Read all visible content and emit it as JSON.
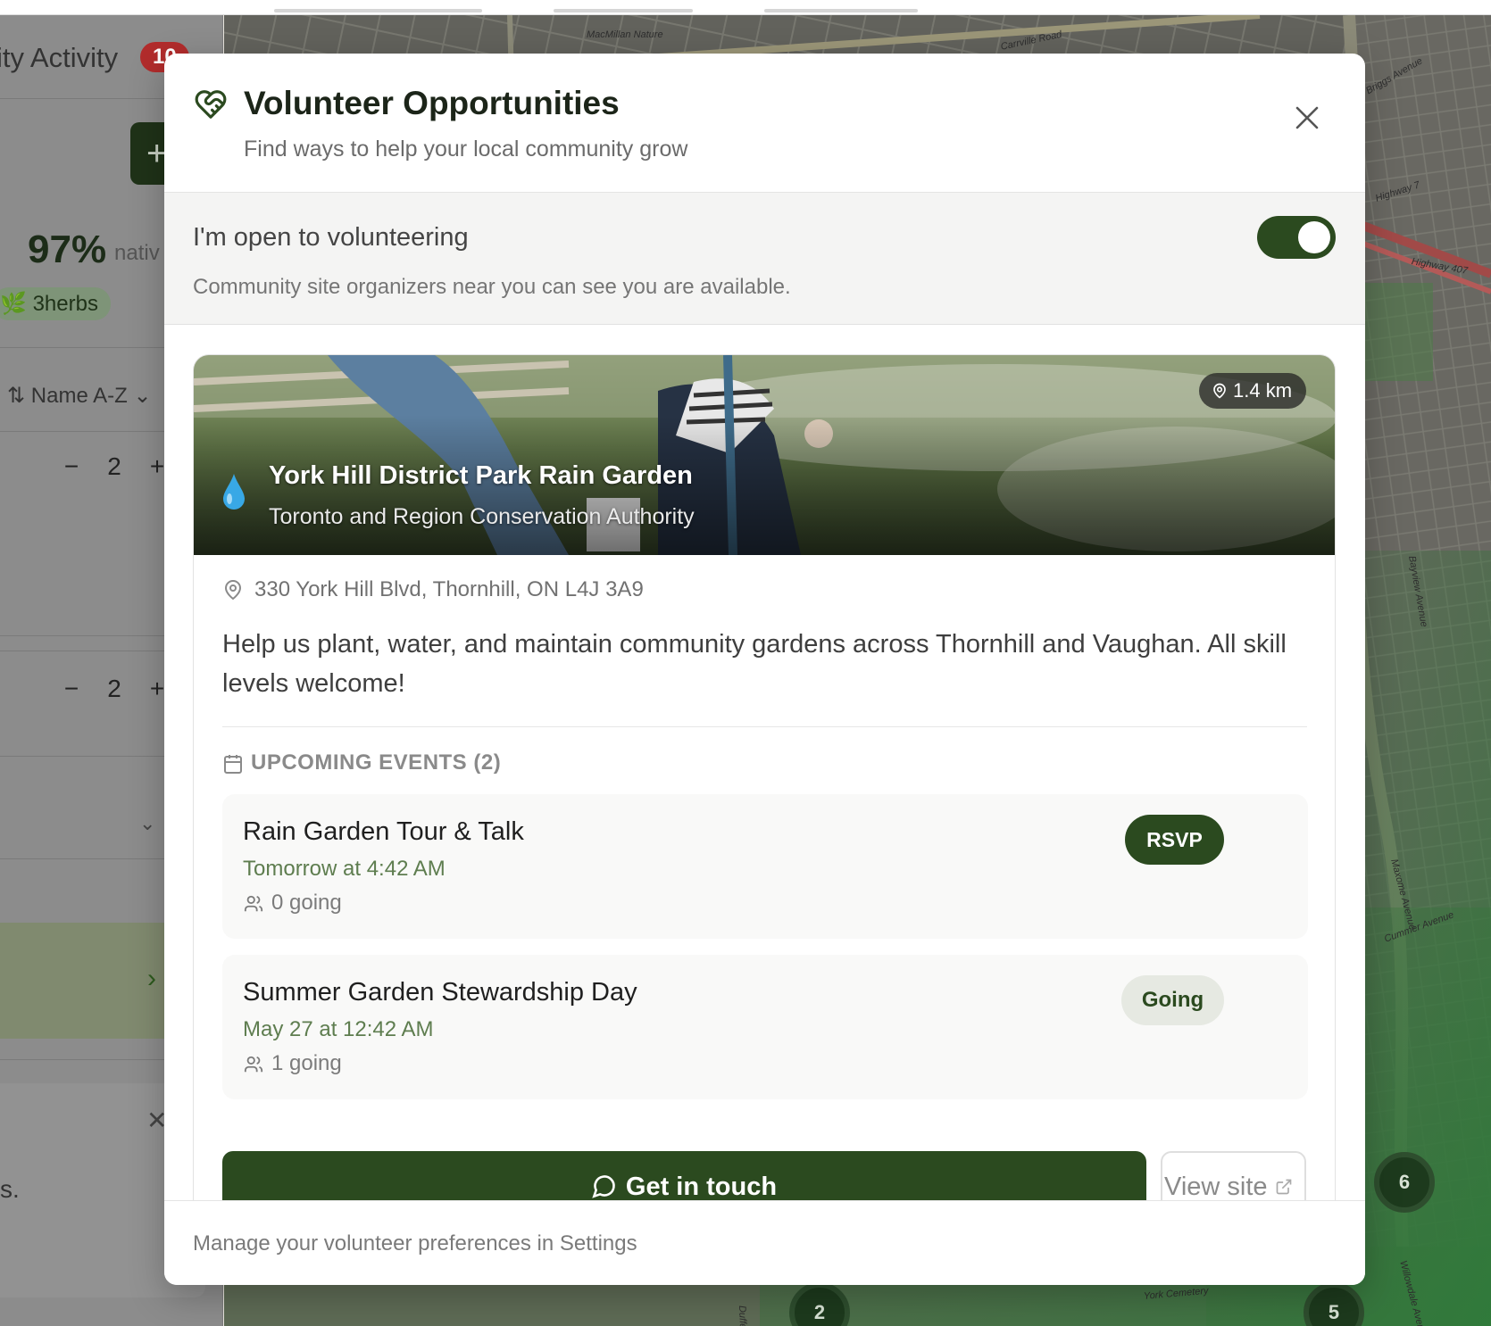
{
  "background": {
    "left_panel": {
      "title": "ity Activity",
      "badge": "10",
      "add_glyph": "+",
      "native_pct": "97%",
      "native_label": "nativ",
      "herbs_count": "3",
      "herbs_label": "herbs",
      "sort_label": "Name A-Z",
      "stepper_1": "2",
      "stepper_2": "2",
      "truncated_text": "s."
    },
    "map": {
      "labels": [
        "MacMillan Nature",
        "Carrville Road",
        "Highway 7",
        "Highway 407",
        "Bayview Avenue",
        "Maxome Avenue",
        "Cummer Avenue",
        "Willowdale Avenue",
        "York Cemetery",
        "Dufferin St",
        "Briggs Avenue"
      ],
      "clusters": [
        "6",
        "2",
        "5"
      ]
    }
  },
  "modal": {
    "title": "Volunteer Opportunities",
    "subtitle": "Find ways to help your local community grow",
    "toggle": {
      "label": "I'm open to volunteering",
      "description": "Community site organizers near you can see you are available.",
      "on": true
    },
    "site": {
      "distance": "1.4 km",
      "name": "York Hill District Park Rain Garden",
      "organization": "Toronto and Region Conservation Authority",
      "address": "330 York Hill Blvd, Thornhill, ON L4J 3A9",
      "description": "Help us plant, water, and maintain community gardens across Thornhill and Vaughan. All skill levels welcome!",
      "events_heading": "UPCOMING EVENTS (2)",
      "events": [
        {
          "title": "Rain Garden Tour & Talk",
          "time": "Tomorrow at 4:42 AM",
          "going": "0 going",
          "action": "RSVP"
        },
        {
          "title": "Summer Garden Stewardship Day",
          "time": "May 27 at 12:42 AM",
          "going": "1 going",
          "action": "Going"
        }
      ],
      "contact_label": "Get in touch",
      "view_site_label": "View site"
    },
    "footer": "Manage your volunteer preferences in Settings"
  },
  "colors": {
    "brand_green": "#2b4a1f",
    "event_time_green": "#5e7d4f",
    "badge_red": "#b22c2c"
  },
  "icons": [
    "heart-handshake-icon",
    "close-icon",
    "map-pin-icon",
    "water-drop-icon",
    "calendar-icon",
    "users-icon",
    "message-circle-icon",
    "external-link-icon",
    "plus-icon",
    "minus-icon",
    "sort-icon",
    "chevron-down-icon",
    "chevron-right-icon",
    "leaf-icon"
  ]
}
